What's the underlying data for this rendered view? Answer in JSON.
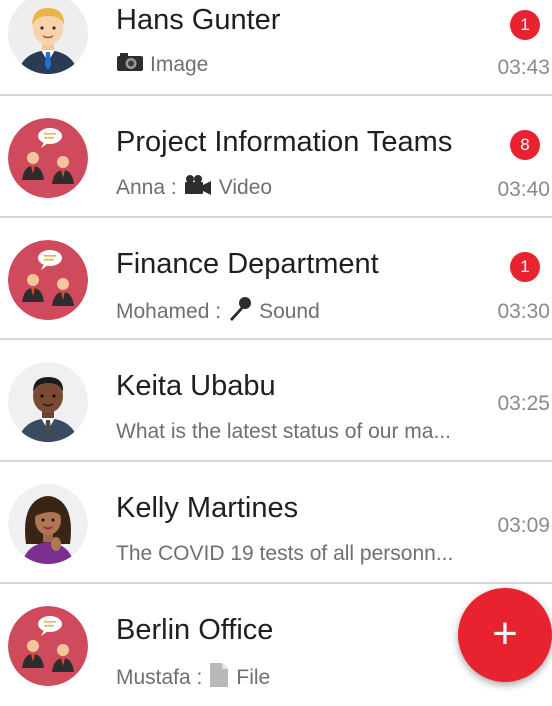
{
  "colors": {
    "accent": "#e8232f",
    "divider": "#d6d6d6"
  },
  "chats": [
    {
      "name": "Hans Gunter",
      "sender": "",
      "preview": "Image",
      "preview_icon": "camera-icon",
      "time": "03:43",
      "unread": "1",
      "avatar": "man-blond-suit"
    },
    {
      "name": "Project Information Teams",
      "sender": "Anna :",
      "preview": "Video",
      "preview_icon": "video-camera-icon",
      "time": "03:40",
      "unread": "8",
      "avatar": "group"
    },
    {
      "name": "Finance Department",
      "sender": "Mohamed :",
      "preview": "Sound",
      "preview_icon": "microphone-icon",
      "time": "03:30",
      "unread": "1",
      "avatar": "group"
    },
    {
      "name": "Keita Ubabu",
      "sender": "",
      "preview": "What is the latest status of our ma...",
      "preview_icon": "",
      "time": "03:25",
      "unread": "",
      "avatar": "man-dark"
    },
    {
      "name": "Kelly Martines",
      "sender": "",
      "preview": "The COVID 19 tests of all personn...",
      "preview_icon": "",
      "time": "03:09",
      "unread": "",
      "avatar": "woman"
    },
    {
      "name": "Berlin Office",
      "sender": "Mustafa :",
      "preview": "File",
      "preview_icon": "file-icon",
      "time": "",
      "unread": "",
      "avatar": "group"
    }
  ],
  "fab": {
    "label": "+"
  }
}
